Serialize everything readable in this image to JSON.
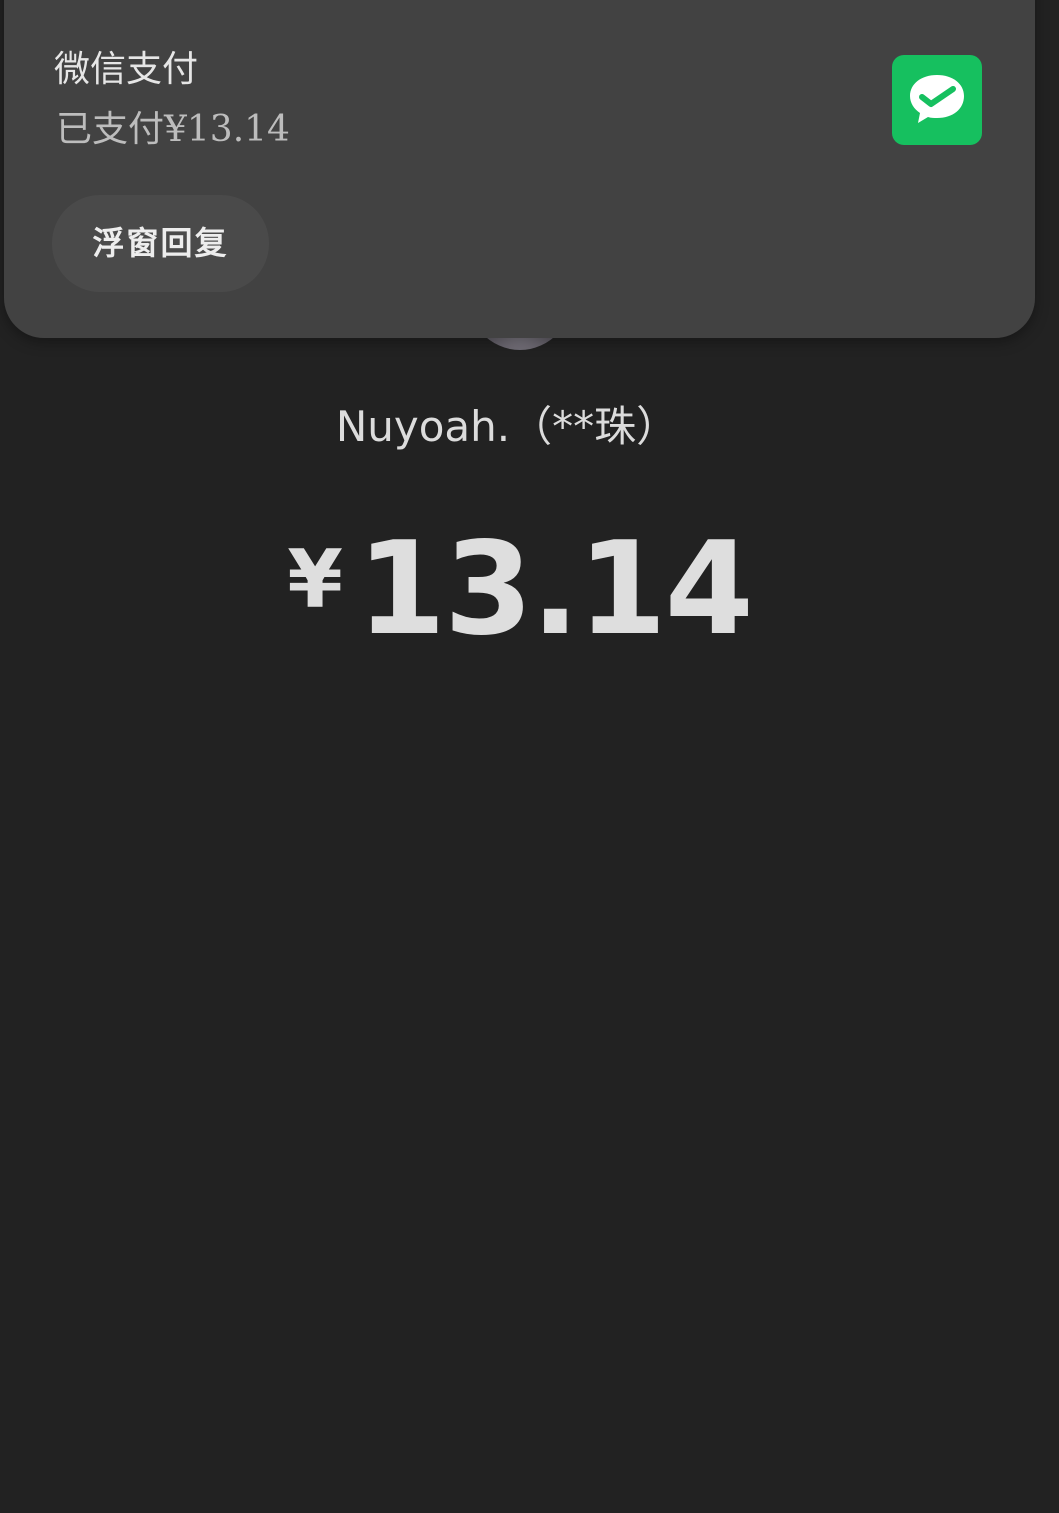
{
  "notification": {
    "app_name": "微信支付",
    "message": "已支付¥13.14",
    "reply_label": "浮窗回复",
    "icon": "wechat-pay-icon",
    "icon_color": "#16c05f"
  },
  "payment": {
    "payee": "Nuyoah.（**珠）",
    "currency_symbol": "¥",
    "amount": "13.14"
  },
  "colors": {
    "background": "#222222",
    "notification_bg": "#424242"
  }
}
